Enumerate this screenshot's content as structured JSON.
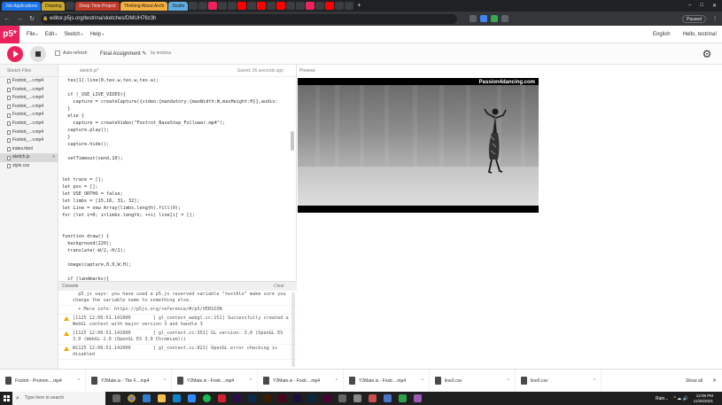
{
  "browser": {
    "tabs": [
      {
        "label": "Job Applications",
        "color": "#1a73e8"
      },
      {
        "label": "Drawing",
        "color": "#f4d03f"
      },
      {
        "label": "",
        "color": "#3c3d41"
      },
      {
        "label": "Deep Time Project",
        "color": "#e74c3c"
      },
      {
        "label": "Thinking About Archi",
        "color": "#f5b041"
      },
      {
        "label": "Studio",
        "color": "#5dade2"
      }
    ],
    "url": "editor.p5js.org/testrina/sketches/DMUH76z3h",
    "paused_label": "Paused"
  },
  "p5": {
    "logo": "p5*",
    "menu": [
      "File",
      "Edit",
      "Sketch",
      "Help"
    ],
    "language": "English",
    "user": "Hello, testrina!",
    "auto_refresh": "Auto-refresh",
    "sketch_name": "Final Assignment ✎",
    "byline": "by testrina",
    "files_header": "Sketch Files",
    "files": [
      "Foxtrot_...r.mp4",
      "Foxtrot_...r.mp4",
      "Foxtrot_...r.mp4",
      "Foxtrot_...r.mp4",
      "Foxtrot_...r.mp4",
      "Foxtrot_...r.mp4",
      "Foxtrot_...r.mp4",
      "Foxtrot_...r.mp4",
      "index.html",
      "sketch.js",
      "style.css"
    ],
    "editor_tab": "sketch.js*",
    "saved_status": "Saved: 26 seconds ago",
    "preview_label": "Preview",
    "video_watermark": "Passion4dancing.com"
  },
  "code_lines": [
    "  tex[1].line(0,tex.w,tex.w,tex.w);",
    "",
    "  if (_USE_LIVE_VIDEO){",
    "    capture = createCapture({video:{mandatory:{maxWidth:W,maxHeight:H}},audio:",
    "  }",
    "  else {",
    "    capture = createVideo(\"Foxtrot_BaseStep_Follower.mp4\");",
    "  capture.play();",
    "  }",
    "  capture.hide();",
    "",
    "  setTimeout(send,10);",
    "",
    "",
    "let trace = [];",
    "let pos = [];",
    "let USE_ORTHO = false;",
    "let limbs = [15,16, 31, 32];",
    "let Line = new Array(limbs.length).fill(0);",
    "for (let i=0; i<limbs.length; ++i) line[i] = [];",
    "",
    "",
    "function draw() {",
    "  background(220);",
    "  translate(-W/2,-H/2);",
    "",
    "  image(capture,0,0,W,H);",
    "",
    "  if (landmarks){",
    "    fill(255,255,0);"
  ],
  "console": {
    "title": "Console",
    "clear": "Clear",
    "messages": [
      {
        "warn": false,
        "text": "  p5.js says: you have used a p5.js reserved variable \"textAlo\" make sure you change the variable name to something else."
      },
      {
        "warn": false,
        "text": "  + More info: https://p5js.org/reference/#/p5/VERSION"
      },
      {
        "warn": true,
        "text": "[1125 12:06:51.141000        ] gl_context_webgl.cc:151] Successfully created a WebGL context with major version 3 and handle 3"
      },
      {
        "warn": true,
        "text": "[1125 12:06:51.141000        ] gl_context.cc:351] GL version: 3.0 (OpenGL ES 3.0 (WebGL 2.0 (OpenGL ES 3.0 Chromium)))"
      },
      {
        "warn": true,
        "text": "W1125 12:06:51.142000        ] gl_context.cc:821] OpenGL error checking is disabled"
      }
    ]
  },
  "downloads": {
    "items": [
      "Foxtrot - Promen....mp4",
      "Y2Mate.is - The F....mp4",
      "Y2Mate.is - Foxtr....mp4",
      "Y2Mate.is - Foxtr....mp4",
      "Y2Mate.is - Foxtr....mp4",
      "line3.csv",
      "line0.csv"
    ],
    "show_all": "Show all"
  },
  "taskbar": {
    "search_placeholder": "Type here to search",
    "weather": "Rain...",
    "time": "12:06 PM",
    "date": "11/25/2021"
  }
}
